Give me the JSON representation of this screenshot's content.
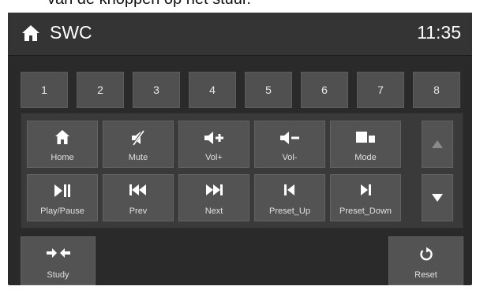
{
  "caption": "van de knoppen op het stuur.",
  "header": {
    "title": "SWC",
    "time": "11:35"
  },
  "number_buttons": [
    "1",
    "2",
    "3",
    "4",
    "5",
    "6",
    "7",
    "8"
  ],
  "function_buttons": {
    "home": "Home",
    "mute": "Mute",
    "vol_up": "Vol+",
    "vol_down": "Vol-",
    "mode": "Mode",
    "play_pause": "Play/Pause",
    "prev": "Prev",
    "next": "Next",
    "preset_up": "Preset_Up",
    "preset_down": "Preset_Down"
  },
  "bottom": {
    "study": "Study",
    "reset": "Reset"
  },
  "colors": {
    "background": "#2a2a2a",
    "button": "#535353",
    "text": "#ffffff",
    "disabled_arrow": "#8a8a8a"
  }
}
